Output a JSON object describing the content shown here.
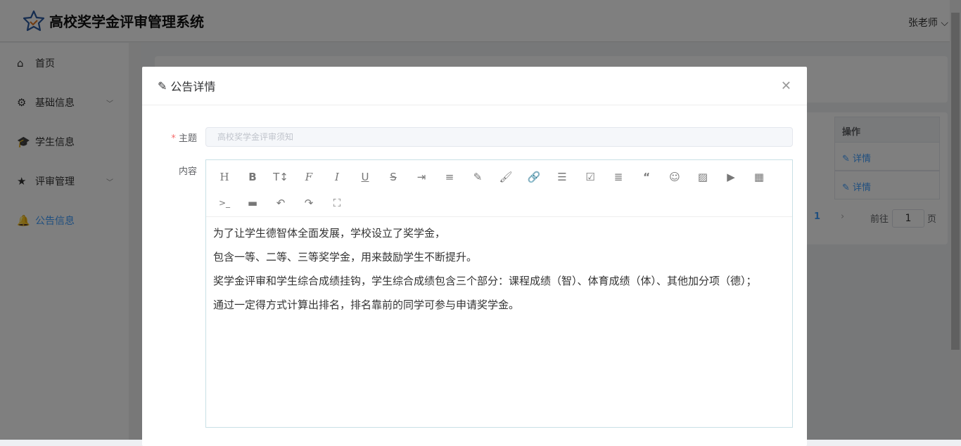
{
  "header": {
    "title": "高校奖学金评审管理系统",
    "user": "张老师"
  },
  "sidebar": {
    "items": [
      {
        "label": "首页",
        "icon": "home-icon"
      },
      {
        "label": "基础信息",
        "icon": "gear-icon"
      },
      {
        "label": "学生信息",
        "icon": "graduation-cap-icon"
      },
      {
        "label": "评审管理",
        "icon": "star-icon"
      },
      {
        "label": "公告信息",
        "icon": "bell-icon"
      }
    ]
  },
  "table": {
    "header_action": "操作",
    "rows": [
      {
        "action": "详情"
      },
      {
        "action": "详情"
      }
    ]
  },
  "pagination": {
    "current": "1",
    "goto_label": "前往",
    "goto_value": "1",
    "page_suffix": "页"
  },
  "modal": {
    "title": "公告详情",
    "subject_label": "主题",
    "subject_placeholder": "高校奖学金评审须知",
    "content_label": "内容",
    "content": [
      "为了让学生德智体全面发展，学校设立了奖学金，",
      "包含一等、二等、三等奖学金，用来鼓励学生不断提升。",
      "奖学金评审和学生综合成绩挂钩，学生综合成绩包含三个部分：课程成绩（智）、体育成绩（体）、其他加分项（德）；",
      "通过一定得方式计算出排名，排名靠前的同学可参与申请奖学金。"
    ]
  }
}
